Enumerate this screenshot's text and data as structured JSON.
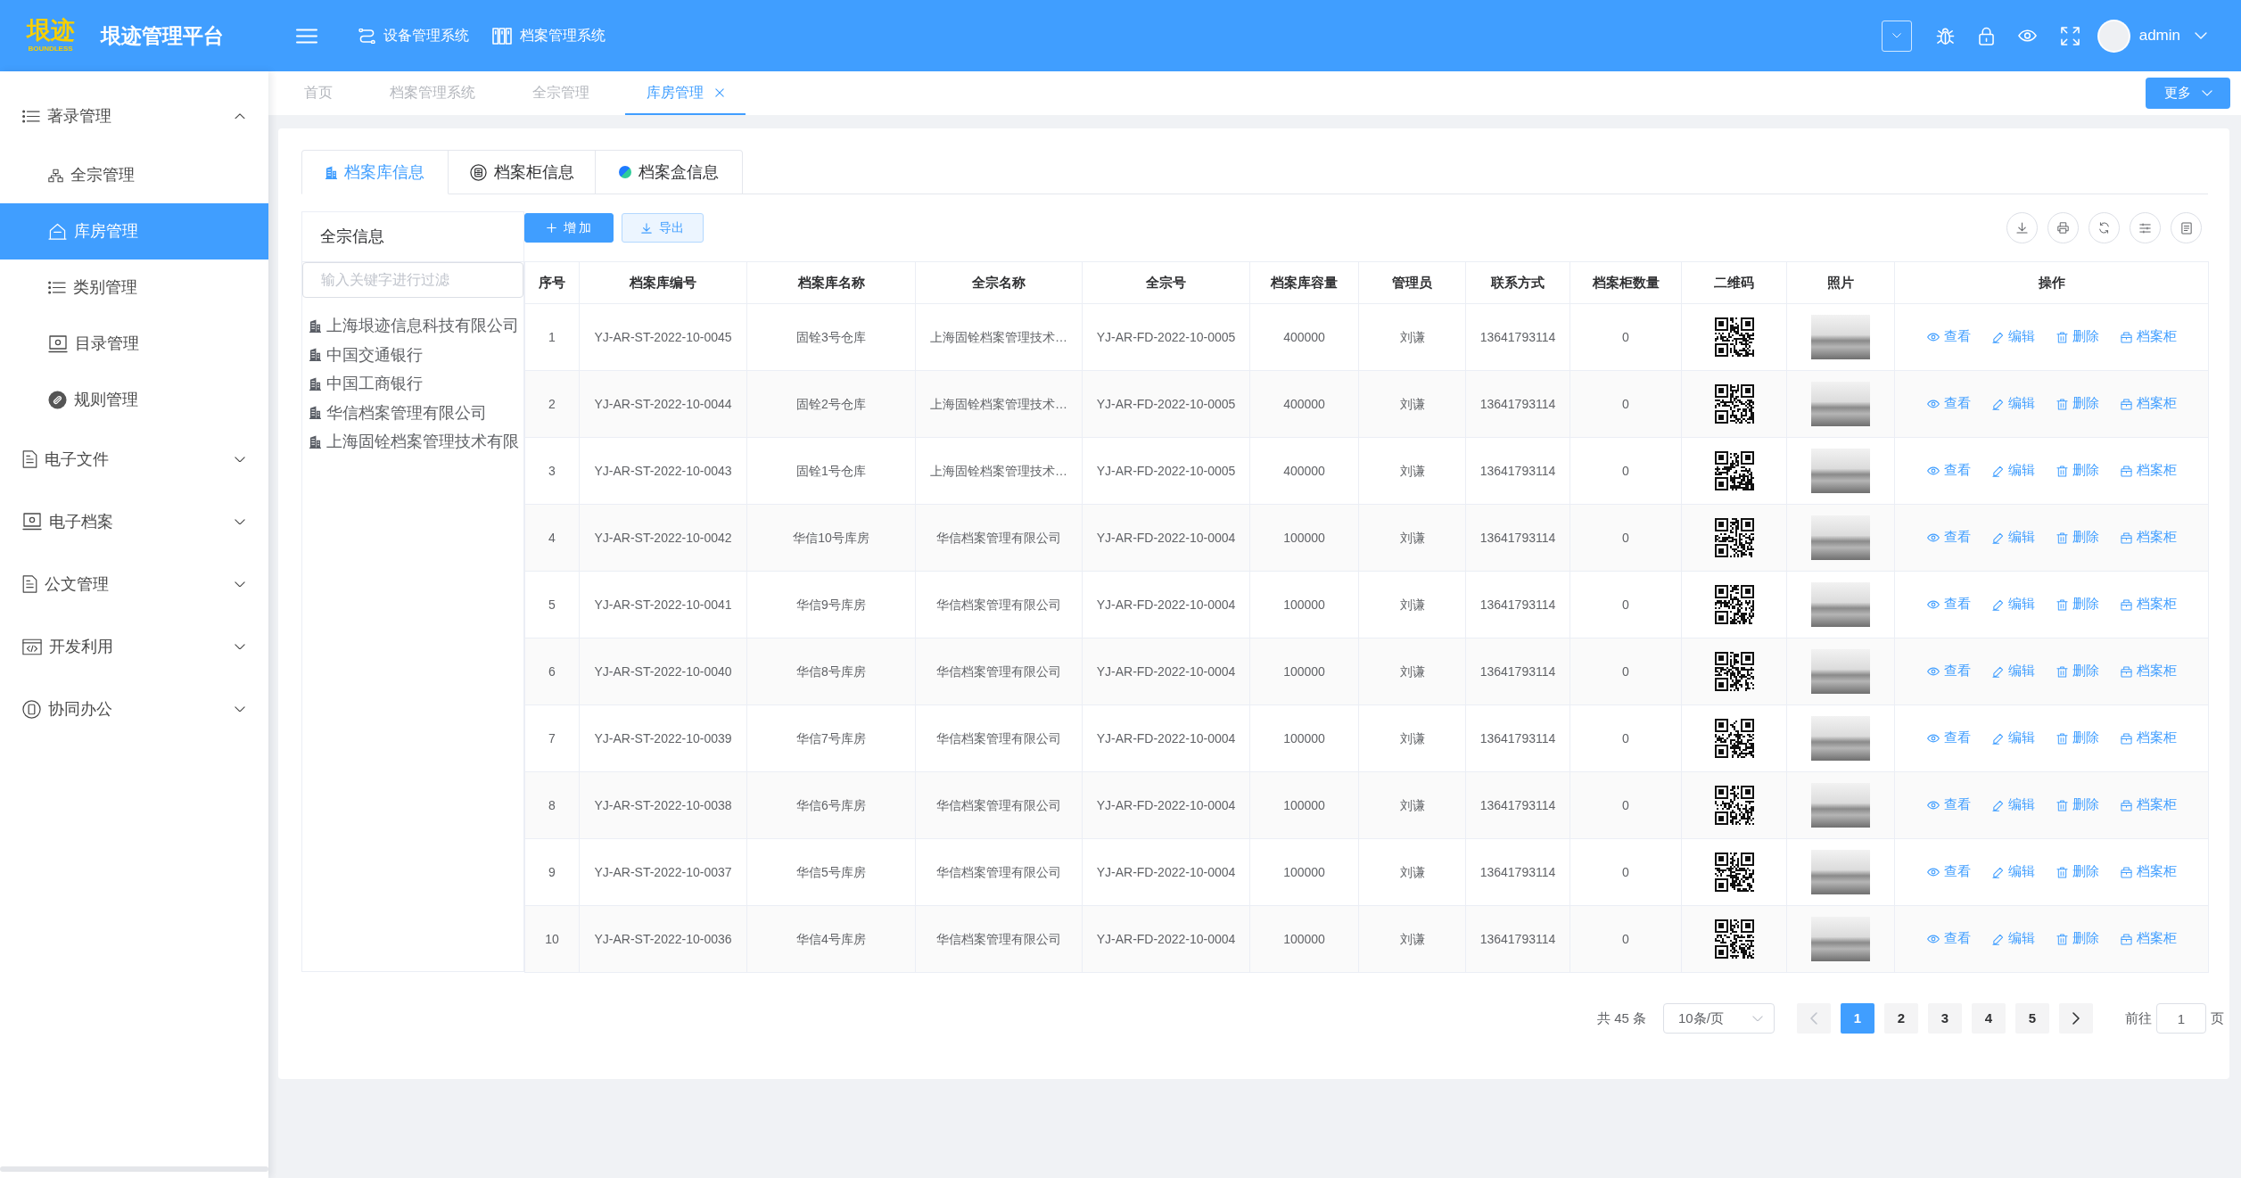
{
  "header": {
    "logo": {
      "mark": "垠迹",
      "tagline": "BOUNDLESS"
    },
    "title": "垠迹管理平台",
    "systems": [
      {
        "label": "设备管理系统"
      },
      {
        "label": "档案管理系统"
      }
    ],
    "user": {
      "name": "admin"
    }
  },
  "sidebar": {
    "items": [
      {
        "label": "著录管理",
        "expanded": true,
        "children": [
          {
            "label": "全宗管理",
            "selected": false
          },
          {
            "label": "库房管理",
            "selected": true
          },
          {
            "label": "类别管理",
            "selected": false
          },
          {
            "label": "目录管理",
            "selected": false
          },
          {
            "label": "规则管理",
            "selected": false
          }
        ]
      },
      {
        "label": "电子文件",
        "expanded": false
      },
      {
        "label": "电子档案",
        "expanded": false
      },
      {
        "label": "公文管理",
        "expanded": false
      },
      {
        "label": "开发利用",
        "expanded": false
      },
      {
        "label": "协同办公",
        "expanded": false
      }
    ]
  },
  "page_tabs": {
    "items": [
      {
        "label": "首页",
        "selected": false
      },
      {
        "label": "档案管理系统",
        "selected": false
      },
      {
        "label": "全宗管理",
        "selected": false
      },
      {
        "label": "库房管理",
        "selected": true
      }
    ],
    "more": "更多"
  },
  "content": {
    "tabs": [
      {
        "label": "档案库信息",
        "selected": true
      },
      {
        "label": "档案柜信息",
        "selected": false
      },
      {
        "label": "档案盒信息",
        "selected": false
      }
    ],
    "tree": {
      "title": "全宗信息",
      "filter": {
        "placeholder": "输入关键字进行过滤"
      },
      "nodes": [
        "上海垠迹信息科技有限公司",
        "中国交通银行",
        "中国工商银行",
        "华信档案管理有限公司",
        "上海固铨档案管理技术有限"
      ]
    },
    "buttons": [
      {
        "label": "增 加",
        "kind": "primary"
      },
      {
        "label": "导出",
        "kind": "plain"
      }
    ],
    "table": {
      "columns": [
        {
          "label": "序号",
          "kind": "text"
        },
        {
          "label": "档案库编号",
          "kind": "text"
        },
        {
          "label": "档案库名称",
          "kind": "text"
        },
        {
          "label": "全宗名称",
          "kind": "text"
        },
        {
          "label": "全宗号",
          "kind": "text"
        },
        {
          "label": "档案库容量",
          "kind": "text"
        },
        {
          "label": "管理员",
          "kind": "text"
        },
        {
          "label": "联系方式",
          "kind": "text"
        },
        {
          "label": "档案柜数量",
          "kind": "text"
        },
        {
          "label": "二维码",
          "kind": "qr"
        },
        {
          "label": "照片",
          "kind": "photo"
        },
        {
          "label": "操作",
          "kind": "actions"
        }
      ],
      "rows": [
        {
          "cells": [
            "1",
            "YJ-AR-ST-2022-10-0045",
            "固铨3号仓库",
            "上海固铨档案管理技术…",
            "YJ-AR-FD-2022-10-0005",
            "400000",
            "刘谦",
            "13641793114",
            "0"
          ],
          "actions": [
            "查看",
            "编辑",
            "删除",
            "档案柜"
          ]
        },
        {
          "cells": [
            "2",
            "YJ-AR-ST-2022-10-0044",
            "固铨2号仓库",
            "上海固铨档案管理技术…",
            "YJ-AR-FD-2022-10-0005",
            "400000",
            "刘谦",
            "13641793114",
            "0"
          ],
          "actions": [
            "查看",
            "编辑",
            "删除",
            "档案柜"
          ]
        },
        {
          "cells": [
            "3",
            "YJ-AR-ST-2022-10-0043",
            "固铨1号仓库",
            "上海固铨档案管理技术…",
            "YJ-AR-FD-2022-10-0005",
            "400000",
            "刘谦",
            "13641793114",
            "0"
          ],
          "actions": [
            "查看",
            "编辑",
            "删除",
            "档案柜"
          ]
        },
        {
          "cells": [
            "4",
            "YJ-AR-ST-2022-10-0042",
            "华信10号库房",
            "华信档案管理有限公司",
            "YJ-AR-FD-2022-10-0004",
            "100000",
            "刘谦",
            "13641793114",
            "0"
          ],
          "actions": [
            "查看",
            "编辑",
            "删除",
            "档案柜"
          ]
        },
        {
          "cells": [
            "5",
            "YJ-AR-ST-2022-10-0041",
            "华信9号库房",
            "华信档案管理有限公司",
            "YJ-AR-FD-2022-10-0004",
            "100000",
            "刘谦",
            "13641793114",
            "0"
          ],
          "actions": [
            "查看",
            "编辑",
            "删除",
            "档案柜"
          ]
        },
        {
          "cells": [
            "6",
            "YJ-AR-ST-2022-10-0040",
            "华信8号库房",
            "华信档案管理有限公司",
            "YJ-AR-FD-2022-10-0004",
            "100000",
            "刘谦",
            "13641793114",
            "0"
          ],
          "actions": [
            "查看",
            "编辑",
            "删除",
            "档案柜"
          ]
        },
        {
          "cells": [
            "7",
            "YJ-AR-ST-2022-10-0039",
            "华信7号库房",
            "华信档案管理有限公司",
            "YJ-AR-FD-2022-10-0004",
            "100000",
            "刘谦",
            "13641793114",
            "0"
          ],
          "actions": [
            "查看",
            "编辑",
            "删除",
            "档案柜"
          ]
        },
        {
          "cells": [
            "8",
            "YJ-AR-ST-2022-10-0038",
            "华信6号库房",
            "华信档案管理有限公司",
            "YJ-AR-FD-2022-10-0004",
            "100000",
            "刘谦",
            "13641793114",
            "0"
          ],
          "actions": [
            "查看",
            "编辑",
            "删除",
            "档案柜"
          ]
        },
        {
          "cells": [
            "9",
            "YJ-AR-ST-2022-10-0037",
            "华信5号库房",
            "华信档案管理有限公司",
            "YJ-AR-FD-2022-10-0004",
            "100000",
            "刘谦",
            "13641793114",
            "0"
          ],
          "actions": [
            "查看",
            "编辑",
            "删除",
            "档案柜"
          ]
        },
        {
          "cells": [
            "10",
            "YJ-AR-ST-2022-10-0036",
            "华信4号库房",
            "华信档案管理有限公司",
            "YJ-AR-FD-2022-10-0004",
            "100000",
            "刘谦",
            "13641793114",
            "0"
          ],
          "actions": [
            "查看",
            "编辑",
            "删除",
            "档案柜"
          ]
        }
      ]
    },
    "pagination": {
      "total": "共 45 条",
      "page_size": "10条/页",
      "prev": {
        "disabled": true
      },
      "pages": [
        {
          "label": "1",
          "selected": true
        },
        {
          "label": "2",
          "selected": false
        },
        {
          "label": "3",
          "selected": false
        },
        {
          "label": "4",
          "selected": false
        },
        {
          "label": "5",
          "selected": false
        }
      ],
      "next": {
        "disabled": false
      },
      "jump": {
        "label": "前往",
        "value": "1",
        "suffix": "页"
      }
    }
  }
}
